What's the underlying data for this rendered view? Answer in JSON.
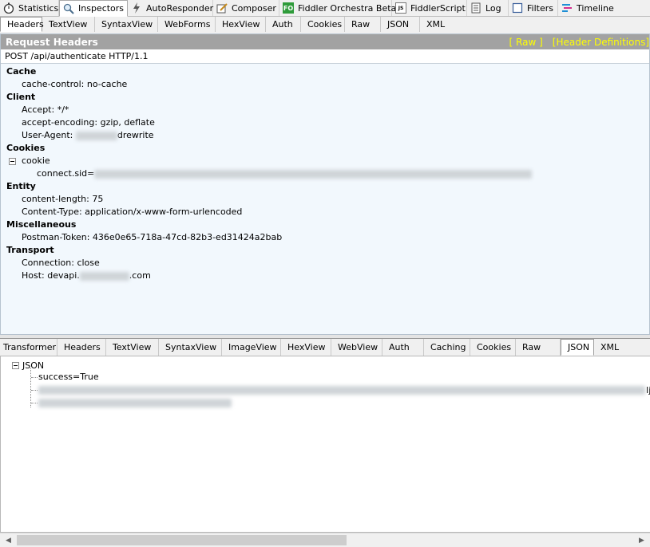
{
  "top_tabs": [
    {
      "label": "Statistics",
      "icon": "stopwatch-icon"
    },
    {
      "label": "Inspectors",
      "icon": "magnifier-icon"
    },
    {
      "label": "AutoResponder",
      "icon": "lightning-icon"
    },
    {
      "label": "Composer",
      "icon": "pencil-icon"
    },
    {
      "label": "Fiddler Orchestra Beta",
      "icon": "fo-icon",
      "icon_text": "FO"
    },
    {
      "label": "FiddlerScript",
      "icon": "script-icon",
      "icon_text": "JS"
    },
    {
      "label": "Log",
      "icon": "log-icon"
    },
    {
      "label": "Filters",
      "icon": "checkbox-icon"
    },
    {
      "label": "Timeline",
      "icon": "timeline-icon"
    }
  ],
  "request_tabs": [
    "Headers",
    "TextView",
    "SyntaxView",
    "WebForms",
    "HexView",
    "Auth",
    "Cookies",
    "Raw",
    "JSON",
    "XML"
  ],
  "request": {
    "title": "Request Headers",
    "raw_link": "[ Raw ]",
    "defs_link": "[Header Definitions]",
    "line": "POST /api/authenticate HTTP/1.1",
    "groups": {
      "cache": "Cache",
      "cache_control": "cache-control: no-cache",
      "client": "Client",
      "accept": "Accept: */*",
      "accept_encoding": "accept-encoding: gzip, deflate",
      "user_agent_prefix": "User-Agent: ",
      "user_agent_suffix": "drewrite",
      "cookies": "Cookies",
      "cookie": "cookie",
      "connect_sid": "connect.sid=",
      "entity": "Entity",
      "content_length": "content-length: 75",
      "content_type": "Content-Type: application/x-www-form-urlencoded",
      "misc": "Miscellaneous",
      "postman_token": "Postman-Token: 436e0e65-718a-47cd-82b3-ed31424a2bab",
      "transport": "Transport",
      "connection": "Connection: close",
      "host_prefix": "Host: devapi.",
      "host_suffix": ".com"
    }
  },
  "response_tabs": [
    "Transformer",
    "Headers",
    "TextView",
    "SyntaxView",
    "ImageView",
    "HexView",
    "WebView",
    "Auth",
    "Caching",
    "Cookies",
    "Raw",
    "JSON",
    "XML"
  ],
  "response": {
    "json_root": "JSON",
    "success": "success=True",
    "trailing_char": "Ij"
  },
  "colors": {
    "title_bar": "#a2a2a2",
    "title_links": "#ffff00",
    "panel_bg": "#f2f8fd"
  }
}
